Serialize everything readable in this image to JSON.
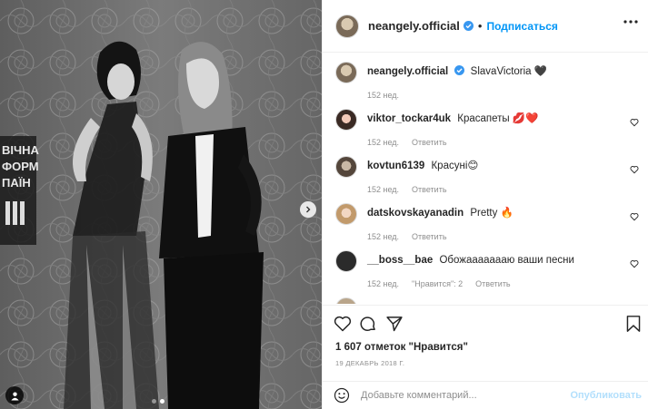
{
  "post": {
    "author": "neangely.official",
    "follow_label": "Подписаться",
    "separator": "•",
    "caption": {
      "user": "neangely.official",
      "text": "SlavaVictoria 🖤",
      "time": "152 нед."
    },
    "comments": [
      {
        "user": "viktor_tockar4uk",
        "text": "Красапеты 💋❤️",
        "time": "152 нед.",
        "reply": "Ответить",
        "likes": ""
      },
      {
        "user": "kovtun6139",
        "text": "Красуні😊",
        "time": "152 нед.",
        "reply": "Ответить",
        "likes": ""
      },
      {
        "user": "datskovskayanadin",
        "text": "Pretty 🔥",
        "time": "152 нед.",
        "reply": "Ответить",
        "likes": ""
      },
      {
        "user": "__boss__bae",
        "text": "Обожаааааааю ваши песни",
        "time": "152 нед.",
        "reply": "Ответить",
        "likes": "\"Нравится\": 2"
      }
    ],
    "likes_text": "1 607 отметок \"Нравится\"",
    "date": "19 ДЕКАБРЬ 2018 Г.",
    "add_comment": {
      "placeholder": "Добавьте комментарий...",
      "post_label": "Опубликовать"
    }
  },
  "photo": {
    "backdrop_text_lines": [
      "ВІЧНА",
      "ФОРМ",
      "ПАЇН"
    ],
    "carousel": {
      "count": 2,
      "active": 1
    }
  },
  "icons": {
    "verified": "verified-badge-icon",
    "more": "more-options-icon",
    "like": "heart-icon",
    "comment": "comment-icon",
    "share": "share-icon",
    "save": "bookmark-icon",
    "emoji": "emoji-icon",
    "next": "chevron-right-icon",
    "tag": "user-tag-icon"
  },
  "colors": {
    "accent": "#0095f6",
    "verified": "#3897f0",
    "muted": "#8e8e8e"
  }
}
